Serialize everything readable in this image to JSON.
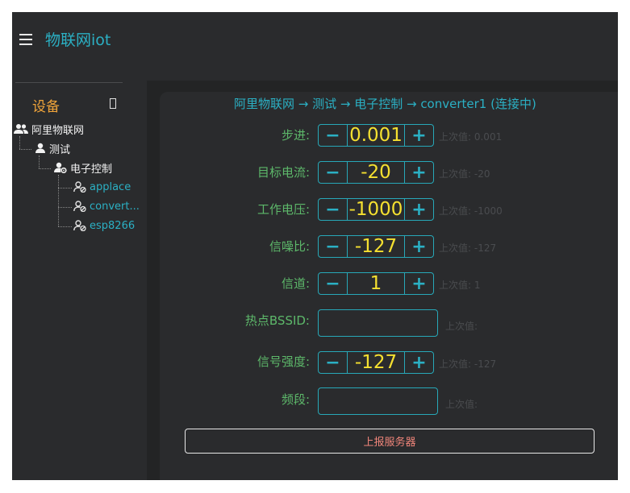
{
  "header": {
    "title": "物联网iot"
  },
  "sidebar": {
    "title": "设备",
    "tree": {
      "root": "阿里物联网",
      "group": "测试",
      "subgroup": "电子控制",
      "devices": [
        "applace",
        "convert...",
        "esp8266"
      ]
    }
  },
  "main": {
    "breadcrumb": "阿里物联网 → 测试 → 电子控制 → converter1 (连接中)",
    "stepper_minus": "−",
    "stepper_plus": "+",
    "fields": [
      {
        "label": "步进:",
        "value": "0.001",
        "last": "上次值: 0.001"
      },
      {
        "label": "目标电流:",
        "value": "-20",
        "last": "上次值: -20"
      },
      {
        "label": "工作电压:",
        "value": "-1000",
        "last": "上次值: -1000"
      },
      {
        "label": "信噪比:",
        "value": "-127",
        "last": "上次值: -127"
      },
      {
        "label": "信道:",
        "value": "1",
        "last": "上次值: 1"
      },
      {
        "label": "热点BSSID:",
        "value": "",
        "last": "上次值:"
      },
      {
        "label": "信号强度:",
        "value": "-127",
        "last": "上次值: -127"
      },
      {
        "label": "频段:",
        "value": "",
        "last": "上次值:"
      }
    ],
    "report_button": "上报服务器"
  },
  "colors": {
    "accent": "#2bb0c4",
    "label_green": "#5db86a",
    "value_yellow": "#f5e030",
    "sidebar_title": "#f0a43a",
    "report_text": "#f0857a",
    "background": "#2a2b2d"
  }
}
